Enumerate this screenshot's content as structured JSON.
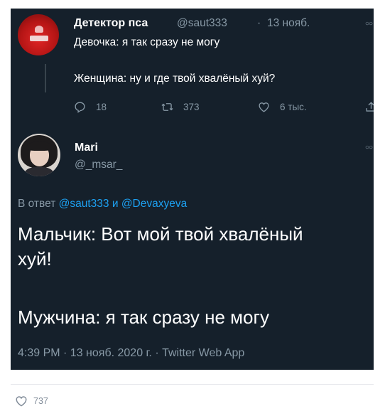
{
  "tweet": {
    "author_name": "Детектор пса",
    "author_handle": "@saut333",
    "separator": "·",
    "date": "13 нояб.",
    "line1": "Девочка: я так сразу не могу",
    "line2": "Женщина: ну и где твой хвалёный хуй?",
    "replies": "18",
    "retweets": "373",
    "likes": "6 тыс."
  },
  "reply": {
    "author_name": "Mari",
    "author_handle": "@_msar_",
    "reply_prefix": "В ответ",
    "mention1": "@saut333",
    "conjunction": "и",
    "mention2": "@Devaxyeva",
    "body_line1": "Мальчик: Вот мой твой хвалёный",
    "body_line2": "хуй!",
    "body_line3": "Мужчина: я так сразу не могу",
    "meta": "4:39 PM · 13 нояб. 2020 г. · Twitter Web App"
  },
  "post_footer": {
    "like_count": "737"
  },
  "colors": {
    "background": "#15202b",
    "primary_text": "#ffffff",
    "secondary_text": "#8899a6",
    "mention": "#1da1f2"
  },
  "icons": [
    "reply-icon",
    "retweet-icon",
    "like-icon",
    "share-icon",
    "more-icon",
    "heart-outline-icon"
  ]
}
